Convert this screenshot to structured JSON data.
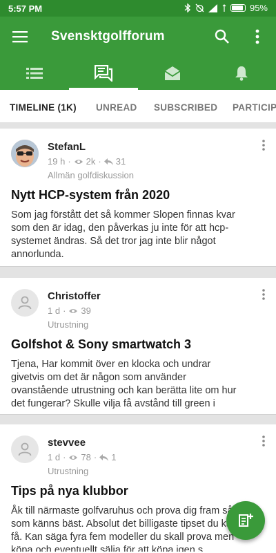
{
  "status_bar": {
    "time": "5:57 PM",
    "battery": "95%",
    "battery_level": 0.95
  },
  "app_bar": {
    "title": "Svensktgolfforum"
  },
  "icon_tabs": [
    {
      "name": "categories",
      "icon": "list-icon"
    },
    {
      "name": "topics",
      "icon": "forum-icon",
      "active": true
    },
    {
      "name": "messages",
      "icon": "mail-icon"
    },
    {
      "name": "notifications",
      "icon": "bell-icon"
    }
  ],
  "filter_tabs": [
    {
      "label": "TIMELINE (1K)",
      "active": true
    },
    {
      "label": "UNREAD"
    },
    {
      "label": "SUBSCRIBED"
    },
    {
      "label": "PARTICIPATED"
    }
  ],
  "posts": [
    {
      "author": "StefanL",
      "time": "19 h",
      "views": "2k",
      "replies": "31",
      "category": "Allmän golfdiskussion",
      "title": "Nytt HCP-system från 2020",
      "excerpt": "Som jag förstått det så kommer Slopen finnas kvar som den är idag, den påverkas ju inte för att hcp-systemet ändras. Så det tror jag inte blir något annorlunda."
    },
    {
      "author": "Christoffer",
      "time": "1 d",
      "views": "39",
      "replies": "",
      "category": "Utrustning",
      "title": "Golfshot & Sony smartwatch 3",
      "excerpt": "Tjena, Har kommit över en klocka och undrar givetvis om det är någon som använder ovanstående utrustning och kan berätta lite om hur det fungerar? Skulle vilja få avstånd till green i"
    },
    {
      "author": "stevvee",
      "time": "1 d",
      "views": "78",
      "replies": "1",
      "category": "Utrustning",
      "title": "Tips på nya klubbor",
      "excerpt": "Åk till närmaste golfvaruhus och prova dig fram så som känns bäst. Absolut det billigaste tipset du kan få. Kan säga fyra fem modeller du skall prova men köpa och eventuellt sälja för att köpa igen s"
    }
  ],
  "colors": {
    "primary": "#3a9a3a",
    "status": "#2e8b2e"
  }
}
